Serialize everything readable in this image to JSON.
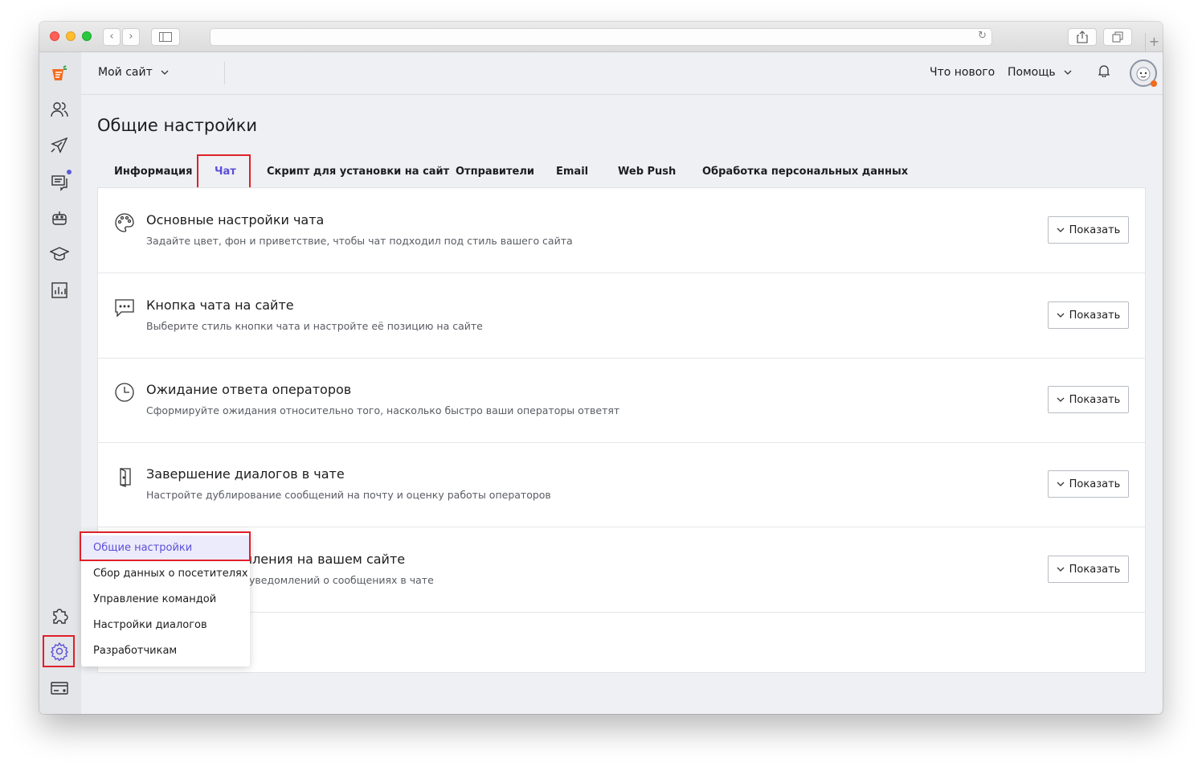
{
  "browser": {
    "back_label": "‹",
    "forward_label": "›",
    "new_tab_label": "+"
  },
  "header": {
    "site_select": "Мой сайт",
    "whats_new": "Что нового",
    "help": "Помощь"
  },
  "page": {
    "title": "Общие настройки"
  },
  "tabs": [
    {
      "label": "Информация"
    },
    {
      "label": "Чат"
    },
    {
      "label": "Скрипт для установки на сайт"
    },
    {
      "label": "Отправители"
    },
    {
      "label": "Email"
    },
    {
      "label": "Web Push"
    },
    {
      "label": "Обработка персональных данных"
    }
  ],
  "active_tab": "Чат",
  "sections": [
    {
      "title": "Основные настройки чата",
      "desc": "Задайте цвет, фон и приветствие, чтобы чат подходил под стиль вашего сайта",
      "button": "Показать"
    },
    {
      "title": "Кнопка чата на сайте",
      "desc": "Выберите стиль кнопки чата и настройте её позицию на сайте",
      "button": "Показать"
    },
    {
      "title": "Ожидание ответа операторов",
      "desc": "Сформируйте ожидания относительно того, насколько быстро ваши операторы ответят",
      "button": "Показать"
    },
    {
      "title": "Завершение диалогов в чате",
      "desc": "Настройте дублирование сообщений на почту и оценку работы операторов",
      "button": "Показать"
    },
    {
      "title": "мления на вашем сайте",
      "desc": "уведомлений о сообщениях в чате",
      "button": "Показать"
    }
  ],
  "settings_menu": {
    "items": [
      {
        "label": "Общие настройки"
      },
      {
        "label": "Сбор данных о посетителях"
      },
      {
        "label": "Управление командой"
      },
      {
        "label": "Настройки диалогов"
      },
      {
        "label": "Разработчикам"
      }
    ],
    "active": "Общие настройки"
  },
  "colors": {
    "accent": "#5b4fd6",
    "highlight": "#e0202a",
    "brand_logo": "#f26b1d"
  }
}
